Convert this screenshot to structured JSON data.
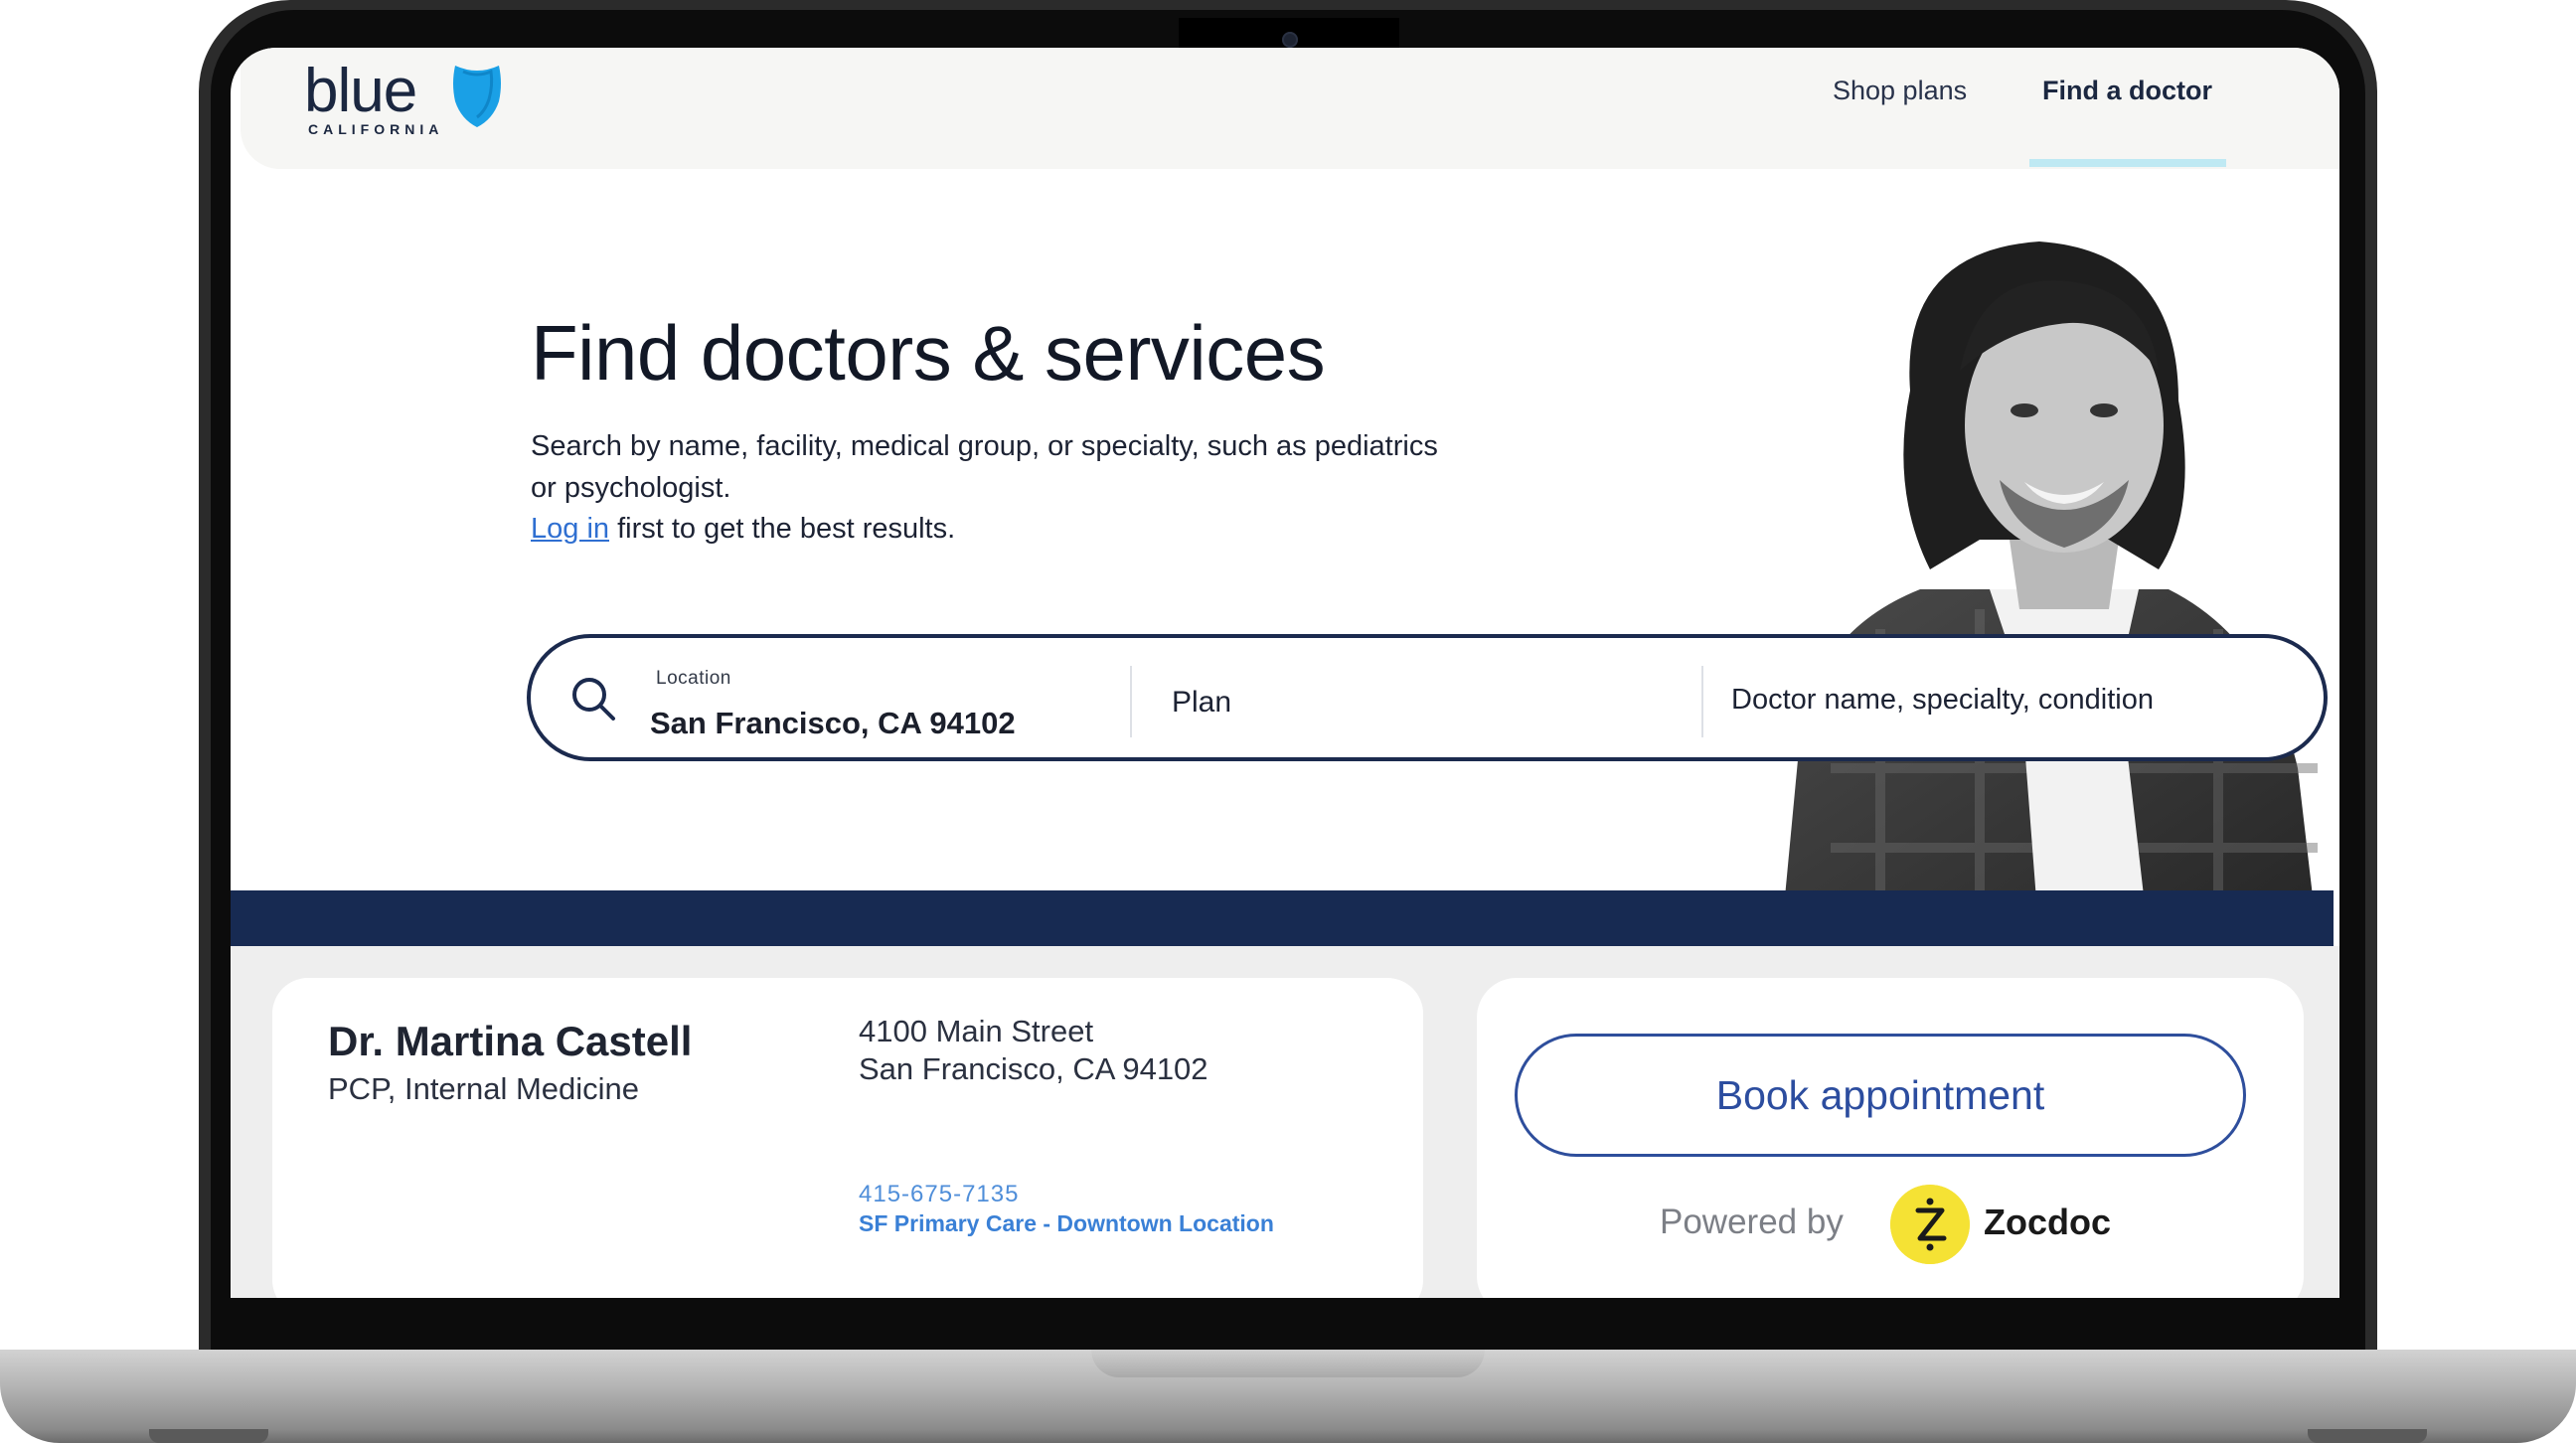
{
  "header": {
    "logo_text": "blue",
    "logo_subtext": "CALIFORNIA",
    "nav": {
      "shop_plans": "Shop plans",
      "find_doctor": "Find a doctor"
    }
  },
  "hero": {
    "title": "Find doctors & services",
    "subtitle": "Search by name, facility, medical group, or specialty, such as pediatrics or psychologist.",
    "login_link": "Log in",
    "login_suffix": " first to get the best results."
  },
  "search": {
    "location_label": "Location",
    "location_value": "San Francisco, CA 94102",
    "plan_placeholder": "Plan",
    "doctor_placeholder": "Doctor name, specialty, condition"
  },
  "result": {
    "name": "Dr. Martina Castell",
    "specialty": "PCP, Internal Medicine",
    "address_line1": "4100 Main Street",
    "address_line2": "San Francisco, CA 94102",
    "phone": "415-675-7135",
    "practice": "SF Primary Care  - Downtown Location",
    "book_label": "Book appointment",
    "powered_by": "Powered by",
    "provider": "Zocdoc"
  },
  "colors": {
    "navy": "#172a52",
    "brand_blue": "#2c4d9f",
    "link_blue": "#2f6fd1",
    "nav_accent": "#bfe9f3",
    "zocdoc_yellow": "#f5e234"
  },
  "icons": [
    "search-icon",
    "shield-icon",
    "zocdoc-icon"
  ]
}
